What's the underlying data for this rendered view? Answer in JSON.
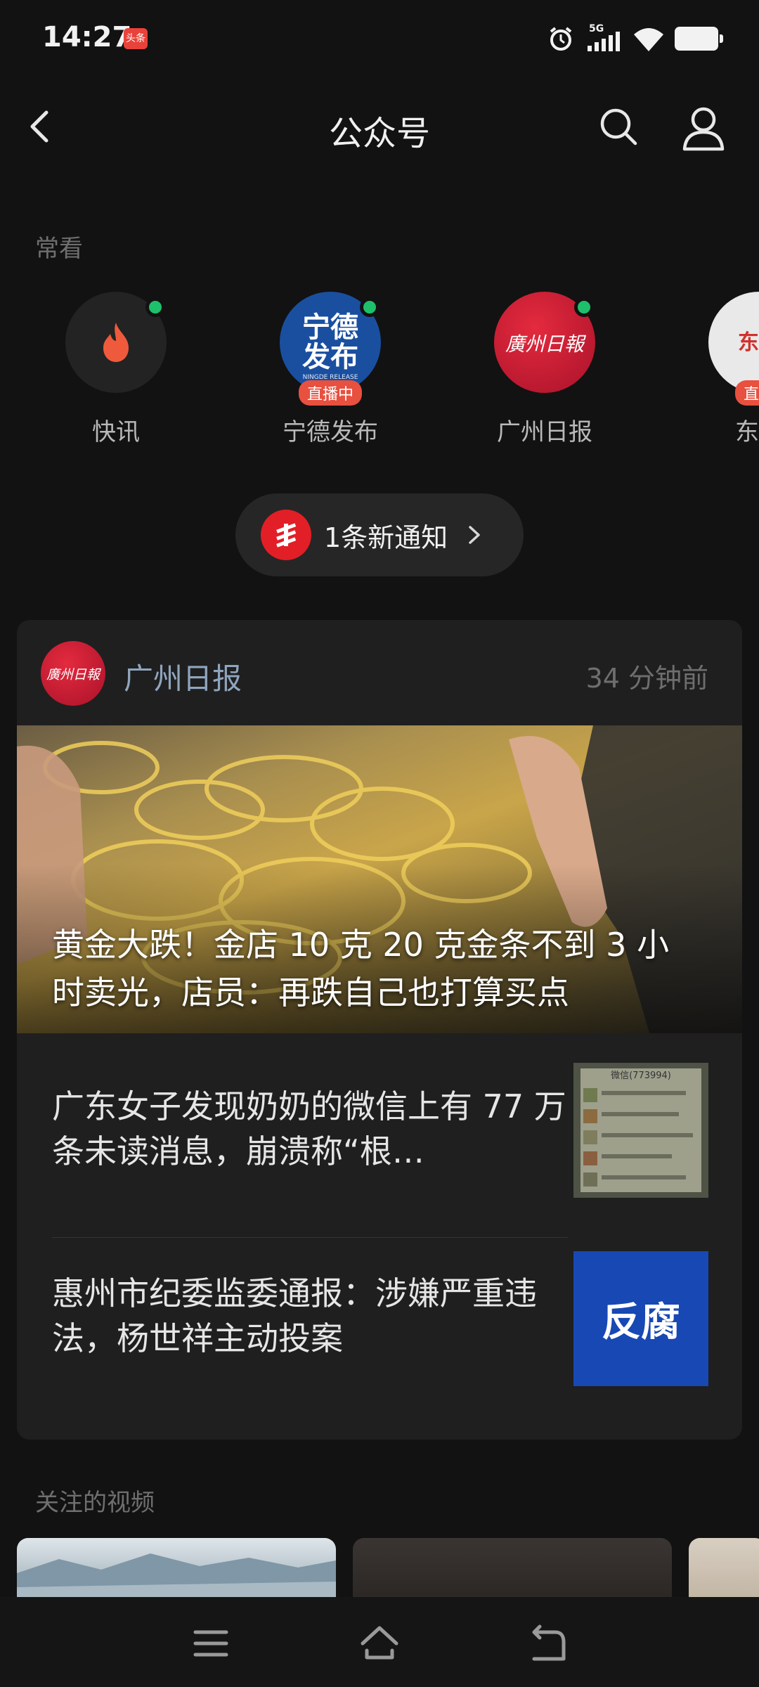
{
  "status": {
    "time": "14:27",
    "app_badge": "头条",
    "network": "5G"
  },
  "header": {
    "title": "公众号"
  },
  "frequent": {
    "label": "常看",
    "items": [
      {
        "name": "快讯",
        "badge": "",
        "online": true
      },
      {
        "name": "宁德发布",
        "badge": "直播中",
        "online": true
      },
      {
        "name": "广州日报",
        "badge": "",
        "online": true
      },
      {
        "name": "东南",
        "badge": "直播",
        "online": false
      }
    ]
  },
  "notification": {
    "text": "1条新通知"
  },
  "card": {
    "source": "广州日报",
    "time": "34 分钟前",
    "hero_title": "黄金大跌！金店 10 克 20 克金条不到 3 小时卖光，店员：再跌自己也打算买点",
    "news": [
      {
        "title": "广东女子发现奶奶的微信上有 77 万条未读消息，崩溃称“根…",
        "thumb_text": "微信(773994)"
      },
      {
        "title": "惠州市纪委监委通报：涉嫌严重违法，杨世祥主动投案",
        "thumb_text": "反腐"
      }
    ]
  },
  "videos": {
    "label": "关注的视频"
  },
  "colors": {
    "background": "#121212",
    "card": "#1f1f1f",
    "live_badge": "#e8503f",
    "online_dot": "#1fc06b",
    "source_text": "#8fa5bd"
  }
}
